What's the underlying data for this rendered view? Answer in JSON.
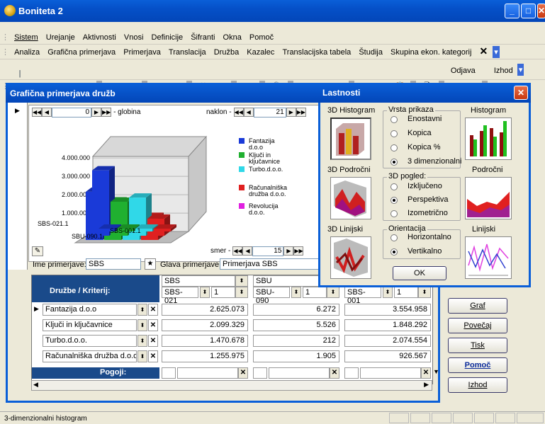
{
  "app": {
    "title": "Boniteta 2"
  },
  "menubar": [
    "Sistem",
    "Urejanje",
    "Aktivnosti",
    "Vnosi",
    "Definicije",
    "Šifranti",
    "Okna",
    "Pomoč"
  ],
  "quickbar": [
    "Analiza",
    "Grafična primerjava",
    "Primerjava",
    "Translacija",
    "Družba",
    "Kazalec",
    "Translacijska tabela",
    "Študija",
    "Skupina ekon. kategorij"
  ],
  "toolbar": {
    "odjava": "Odjava",
    "izhod": "Izhod"
  },
  "window": {
    "title": "Grafična primerjava družb",
    "depth_value": "0",
    "depth_label": "- globina",
    "tilt_label": "naklon -",
    "tilt_value": "21",
    "direction_label": "smer -",
    "direction_value": "15",
    "name_label": "Ime primerjave:",
    "name_value": "SBS",
    "head_label": "Glava primerjave:",
    "head_value": "Primerjava SBS",
    "grid_header": "Družbe / Kriterij:",
    "conditions_label": "Pogoji:"
  },
  "columns": [
    {
      "group": "SBS",
      "code": "SBS-021",
      "n": "1"
    },
    {
      "group": "SBU",
      "code": "SBU-090",
      "n": "1"
    },
    {
      "group": "",
      "code": "SBS-001",
      "n": "1"
    }
  ],
  "rows": [
    {
      "name": "Fantazija d.o.o",
      "v": [
        "2.625.073",
        "6.272",
        "3.554.958"
      ]
    },
    {
      "name": "Ključi in ključavnice",
      "v": [
        "2.099.329",
        "5.526",
        "1.848.292"
      ]
    },
    {
      "name": "Turbo.d.o.o.",
      "v": [
        "1.470.678",
        "212",
        "2.074.554"
      ]
    },
    {
      "name": "Računalniška družba d.o.o.",
      "v": [
        "1.255.975",
        "1.905",
        "926.567"
      ]
    }
  ],
  "buttons": {
    "graf": "Graf",
    "povecaj": "Povečaj",
    "tisk": "Tisk",
    "pomoc": "Pomoč",
    "izhod": "Izhod"
  },
  "chart_data": {
    "type": "bar",
    "y_ticks": [
      "4.000.000",
      "3.000.000",
      "2.000.000",
      "1.000.000",
      "0"
    ],
    "categories": [
      "SBS-021.1",
      "SBS-001.1",
      "SBU-090.1"
    ],
    "ylim": [
      0,
      4000000
    ],
    "series": [
      {
        "name": "Fantazija d.o.o.",
        "color": "#1a3ad8",
        "values": [
          2625073,
          3554958,
          6272
        ]
      },
      {
        "name": "Ključi in ključavnice",
        "color": "#20b030",
        "values": [
          2099329,
          1848292,
          5526
        ]
      },
      {
        "name": "Turbo.d.o.o.",
        "color": "#30d8e8",
        "values": [
          1470678,
          2074554,
          212
        ]
      },
      {
        "name": "Računalniška družba d.o.o.",
        "color": "#e02020",
        "values": [
          1255975,
          926567,
          1905
        ]
      },
      {
        "name": "Revolucija d.o.o.",
        "color": "#e020e0",
        "values": [
          null,
          null,
          null
        ]
      }
    ],
    "legend_labels": [
      [
        "Fantazija",
        "d.o.o"
      ],
      [
        "Ključi in",
        "ključavnice"
      ],
      [
        "Turbo.d.o.o."
      ],
      [
        "Računalniška",
        "družba d.o.o."
      ],
      [
        "Revolucija",
        "d.o.o."
      ]
    ]
  },
  "dialog": {
    "title": "Lastnosti",
    "thumb_3d_hist": "3D Histogram",
    "thumb_3d_area": "3D Področni",
    "thumb_3d_line": "3D Linijski",
    "thumb_hist": "Histogram",
    "thumb_area": "Področni",
    "thumb_line": "Linijski",
    "group_type": "Vrsta prikaza",
    "type_options": [
      "Enostavni",
      "Kopica",
      "Kopica %",
      "3 dimenzionalni"
    ],
    "type_selected": 3,
    "group_view": "3D pogled:",
    "view_options": [
      "Izključeno",
      "Perspektiva",
      "Izometrično"
    ],
    "view_selected": 1,
    "group_orient": "Orientacija",
    "orient_options": [
      "Horizontalno",
      "Vertikalno"
    ],
    "orient_selected": 1,
    "ok": "OK"
  },
  "status": {
    "text": "3-dimenzionalni histogram"
  }
}
